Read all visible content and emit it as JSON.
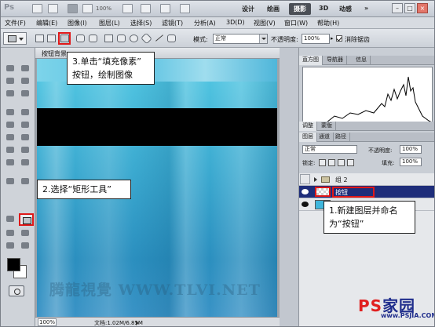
{
  "app": {
    "logo": "Ps",
    "zoom_readout": "100%",
    "workspaces": [
      "设计",
      "绘画",
      "摄影",
      "3D",
      "动感"
    ],
    "active_workspace": "摄影",
    "window_controls": [
      "–",
      "□",
      "×"
    ]
  },
  "menu": [
    "文件(F)",
    "编辑(E)",
    "图像(I)",
    "图层(L)",
    "选择(S)",
    "滤镜(T)",
    "分析(A)",
    "3D(D)",
    "视图(V)",
    "窗口(W)",
    "帮助(H)"
  ],
  "options": {
    "mode_label": "模式:",
    "mode_value": "正常",
    "opacity_label": "不透明度:",
    "opacity_value": "100%",
    "antialias_label": "消除锯齿"
  },
  "document": {
    "tab_title": "按钮背景...",
    "zoom": "100%",
    "doc_info": "文档:1.02M/6.85M",
    "watermark": "腾龍視覺 WWW.TLVI.NET"
  },
  "callouts": {
    "step3_line1": "3.单击“填充像素”",
    "step3_line2": "按钮，绘制图像",
    "step2": "2.选择“矩形工具”",
    "step1_line1": "1.新建图层并命名",
    "step1_line2": "为“按钮”"
  },
  "panels": {
    "top_tabs": [
      "直方图",
      "导航器",
      "信息"
    ],
    "mid_tabs": [
      "调整",
      "蒙版"
    ],
    "layer_tabs": [
      "图层",
      "通道",
      "路径"
    ],
    "blend_mode": "正常",
    "opacity_label": "不透明度:",
    "opacity_value": "100%",
    "lock_label": "锁定:",
    "fill_label": "填充:",
    "fill_value": "100%"
  },
  "layers": [
    {
      "name": "组 2",
      "kind": "group",
      "visible": false,
      "selected": false
    },
    {
      "name": "按钮",
      "kind": "layer",
      "visible": true,
      "selected": true
    },
    {
      "name": "",
      "kind": "image",
      "visible": true,
      "selected": false
    }
  ],
  "branding": {
    "logo_text": "PS",
    "logo_text2": "家园",
    "url": "www.PSJIA.COM"
  },
  "colors": {
    "highlight_red": "#e01818",
    "selected_layer": "#1e2d7a",
    "canvas_blue": "#3aa8cf"
  }
}
